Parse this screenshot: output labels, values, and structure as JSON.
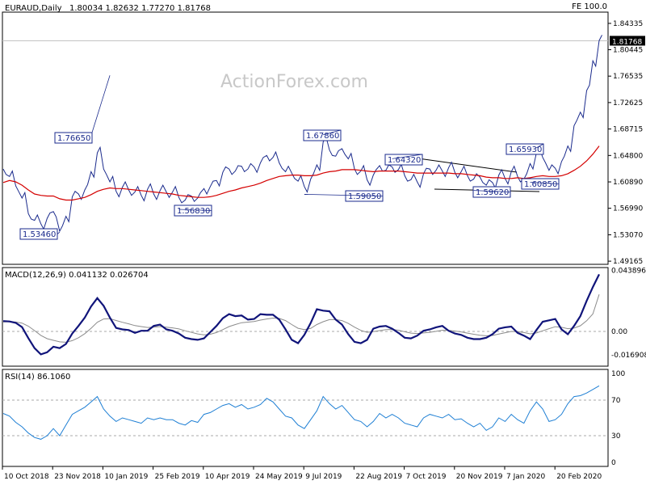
{
  "header": {
    "symbol": "EURAUD,Daily",
    "ohlc": "1.80034 1.82632 1.77270 1.81768",
    "fe_label": "FE 100.0",
    "watermark": "ActionForex.com"
  },
  "chart_data": [
    {
      "type": "line",
      "panel": "price",
      "title": "EURAUD,Daily",
      "ylim": [
        1.487,
        1.86
      ],
      "y_ticks": [
        "1.84335",
        "1.80445",
        "1.76535",
        "1.72625",
        "1.68715",
        "1.64800",
        "1.60890",
        "1.56990",
        "1.53070",
        "1.49165"
      ],
      "x_ticks": [
        "10 Oct 2018",
        "23 Nov 2018",
        "10 Jan 2019",
        "25 Feb 2019",
        "10 Apr 2019",
        "24 May 2019",
        "9 Jul 2019",
        "22 Aug 2019",
        "7 Oct 2019",
        "20 Nov 2019",
        "7 Jan 2020",
        "20 Feb 2020"
      ],
      "current_price": "1.81768",
      "current_value": 1.81768,
      "annotations": [
        {
          "text": "1.76650",
          "value": 1.7665
        },
        {
          "text": "1.53460",
          "value": 1.5346
        },
        {
          "text": "1.56830",
          "value": 1.5683
        },
        {
          "text": "1.67860",
          "value": 1.6786
        },
        {
          "text": "1.59050",
          "value": 1.5905
        },
        {
          "text": "1.64320",
          "value": 1.6432
        },
        {
          "text": "1.59620",
          "value": 1.5962
        },
        {
          "text": "1.65930",
          "value": 1.6593
        },
        {
          "text": "1.60850",
          "value": 1.6085
        }
      ],
      "series": [
        {
          "values": [
            1.628,
            1.617,
            1.603,
            1.585,
            1.562,
            1.552,
            1.547,
            1.555,
            1.565,
            1.536,
            1.558,
            1.587,
            1.591,
            1.597,
            1.624,
            1.652,
            1.628,
            1.609,
            1.595,
            1.601,
            1.597,
            1.594,
            1.589,
            1.598,
            1.591,
            1.596,
            1.594,
            1.594,
            1.586,
            1.582,
            1.588,
            1.585,
            1.599,
            1.602,
            1.611,
            1.623,
            1.628,
            1.625,
            1.632,
            1.628,
            1.631,
            1.637,
            1.648,
            1.645,
            1.637,
            1.624,
            1.622,
            1.61,
            1.602,
            1.613,
            1.634,
            1.668,
            1.656,
            1.647,
            1.658,
            1.643,
            1.628,
            1.625,
            1.612,
            1.619,
            1.633,
            1.626,
            1.631,
            1.627,
            1.618,
            1.612,
            1.609,
            1.621,
            1.628,
            1.626,
            1.625,
            1.63,
            1.623,
            1.624,
            1.618,
            1.613,
            1.616,
            1.604,
            1.608,
            1.619,
            1.614,
            1.624,
            1.617,
            1.613,
            1.636,
            1.652,
            1.645,
            1.626,
            1.629,
            1.639,
            1.662,
            1.692,
            1.712,
            1.744,
            1.788,
            1.818
          ]
        },
        {
          "values": [
            1.608,
            1.611,
            1.609,
            1.604,
            1.597,
            1.591,
            1.589,
            1.588,
            1.588,
            1.584,
            1.582,
            1.582,
            1.584,
            1.586,
            1.59,
            1.595,
            1.598,
            1.6,
            1.599,
            1.599,
            1.598,
            1.597,
            1.596,
            1.595,
            1.594,
            1.593,
            1.592,
            1.591,
            1.589,
            1.588,
            1.587,
            1.586,
            1.586,
            1.587,
            1.589,
            1.592,
            1.595,
            1.597,
            1.6,
            1.602,
            1.604,
            1.607,
            1.611,
            1.614,
            1.617,
            1.618,
            1.619,
            1.619,
            1.618,
            1.618,
            1.619,
            1.622,
            1.624,
            1.625,
            1.627,
            1.627,
            1.627,
            1.626,
            1.625,
            1.624,
            1.625,
            1.625,
            1.625,
            1.625,
            1.624,
            1.623,
            1.622,
            1.622,
            1.622,
            1.622,
            1.622,
            1.622,
            1.621,
            1.621,
            1.62,
            1.619,
            1.618,
            1.616,
            1.615,
            1.615,
            1.614,
            1.614,
            1.615,
            1.614,
            1.615,
            1.617,
            1.618,
            1.617,
            1.617,
            1.618,
            1.621,
            1.626,
            1.632,
            1.64,
            1.65,
            1.662
          ]
        }
      ],
      "colors": {
        "price": "#1a2a8c",
        "ma": "#d40000"
      }
    },
    {
      "type": "line",
      "panel": "macd",
      "title": "MACD(12,26,9) 0.041132 0.026704",
      "ylim": [
        -0.025,
        0.046
      ],
      "y_ticks": [
        "0.043896",
        "0.00",
        "-0.016908"
      ],
      "series": [
        {
          "values": [
            0.0075,
            0.0072,
            0.0062,
            0.0031,
            -0.0048,
            -0.012,
            -0.0165,
            -0.015,
            -0.011,
            -0.012,
            -0.009,
            -0.0015,
            0.004,
            0.01,
            0.018,
            0.024,
            0.0185,
            0.01,
            0.0025,
            0.0015,
            0.001,
            -0.001,
            0.0005,
            0.0005,
            0.004,
            0.005,
            0.0015,
            0.0005,
            -0.0015,
            -0.0045,
            -0.0055,
            -0.006,
            -0.005,
            -0.0005,
            0.004,
            0.0095,
            0.0125,
            0.011,
            0.0115,
            0.0085,
            0.009,
            0.0125,
            0.012,
            0.012,
            0.0085,
            0.0015,
            -0.006,
            -0.0085,
            -0.0025,
            0.006,
            0.016,
            0.015,
            0.0145,
            0.0085,
            0.005,
            -0.002,
            -0.0075,
            -0.0085,
            -0.006,
            0.002,
            0.0035,
            0.004,
            0.002,
            -0.001,
            -0.0045,
            -0.005,
            -0.003,
            0.0005,
            0.0015,
            0.003,
            0.004,
            0.0005,
            -0.0015,
            -0.0025,
            -0.0045,
            -0.0055,
            -0.0055,
            -0.0045,
            -0.002,
            0.002,
            0.003,
            0.0035,
            -0.001,
            -0.003,
            -0.0055,
            0.001,
            0.007,
            0.008,
            0.009,
            0.0015,
            -0.002,
            0.004,
            0.011,
            0.022,
            0.032,
            0.0411
          ]
        },
        {
          "values": [
            0.0068,
            0.007,
            0.0068,
            0.006,
            0.0038,
            0.0006,
            -0.0028,
            -0.0052,
            -0.0064,
            -0.0075,
            -0.0078,
            -0.0066,
            -0.0045,
            -0.0016,
            0.0023,
            0.0066,
            0.009,
            0.0092,
            0.0079,
            0.0066,
            0.0055,
            0.0042,
            0.0035,
            0.0029,
            0.0031,
            0.0035,
            0.0031,
            0.0026,
            0.0018,
            0.0005,
            -0.0007,
            -0.0018,
            -0.0024,
            -0.002,
            -0.0008,
            0.0013,
            0.0035,
            0.005,
            0.0063,
            0.0067,
            0.0072,
            0.0082,
            0.009,
            0.0096,
            0.0094,
            0.0078,
            0.005,
            0.0023,
            0.0013,
            0.0022,
            0.005,
            0.007,
            0.0085,
            0.0085,
            0.0078,
            0.0058,
            0.0031,
            0.0008,
            -0.0006,
            -0.0001,
            0.0006,
            0.0013,
            0.0014,
            0.0009,
            -0.0002,
            -0.0012,
            -0.0015,
            -0.0011,
            -0.0006,
            0.0001,
            0.0009,
            0.0008,
            0.0003,
            -0.0003,
            -0.0012,
            -0.002,
            -0.0027,
            -0.0031,
            -0.0029,
            -0.0019,
            -0.0009,
            0.0,
            -0.0002,
            -0.0008,
            -0.0017,
            -0.0011,
            0.0005,
            0.002,
            0.0034,
            0.003,
            0.002,
            0.0024,
            0.0041,
            0.0077,
            0.0126,
            0.0267
          ]
        }
      ],
      "colors": {
        "macd": "#10147a",
        "signal": "#8c8c8c"
      }
    },
    {
      "type": "line",
      "panel": "rsi",
      "title": "RSI(14) 86.1060",
      "ylim": [
        0,
        100
      ],
      "y_ticks": [
        "100",
        "70",
        "30",
        "0"
      ],
      "levels": [
        70,
        30
      ],
      "series": [
        {
          "values": [
            55,
            52,
            45,
            40,
            33,
            28,
            26,
            30,
            38,
            30,
            42,
            54,
            58,
            62,
            68,
            74,
            60,
            52,
            46,
            50,
            48,
            46,
            44,
            50,
            48,
            50,
            48,
            48,
            44,
            42,
            47,
            45,
            54,
            56,
            60,
            64,
            66,
            62,
            65,
            60,
            62,
            65,
            72,
            68,
            60,
            52,
            50,
            42,
            38,
            48,
            58,
            74,
            66,
            60,
            64,
            56,
            48,
            46,
            40,
            46,
            55,
            50,
            54,
            50,
            44,
            42,
            40,
            50,
            54,
            52,
            50,
            54,
            48,
            49,
            44,
            40,
            44,
            36,
            40,
            50,
            46,
            54,
            48,
            44,
            58,
            68,
            60,
            46,
            48,
            54,
            66,
            74,
            75,
            78,
            82,
            86.106
          ]
        }
      ],
      "colors": {
        "rsi": "#1e7fd4"
      }
    }
  ]
}
